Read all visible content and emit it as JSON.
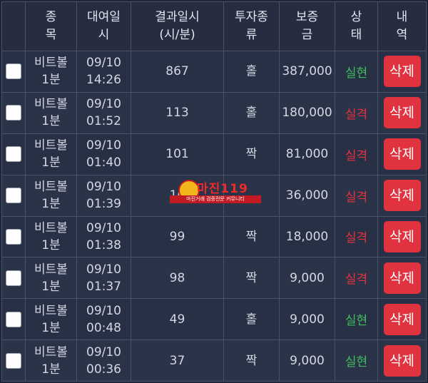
{
  "headers": {
    "check": "",
    "type": [
      "종",
      "목"
    ],
    "bet_time": [
      "대여일",
      "시"
    ],
    "result_time": [
      "결과일시",
      "(시/분)"
    ],
    "pick_type": [
      "투자종",
      "류"
    ],
    "amount": [
      "보증",
      "금"
    ],
    "status": [
      "상",
      "태"
    ],
    "action": [
      "내",
      "역"
    ]
  },
  "rows": [
    {
      "game": [
        "비트볼",
        "1분"
      ],
      "date": [
        "09/10",
        "14:26"
      ],
      "result": "867",
      "pick": "홀",
      "amount": "387,000",
      "status": "실현",
      "action": "삭제"
    },
    {
      "game": [
        "비트볼",
        "1분"
      ],
      "date": [
        "09/10",
        "01:52"
      ],
      "result": "113",
      "pick": "홀",
      "amount": "180,000",
      "status": "실격",
      "action": "삭제"
    },
    {
      "game": [
        "비트볼",
        "1분"
      ],
      "date": [
        "09/10",
        "01:40"
      ],
      "result": "101",
      "pick": "짝",
      "amount": "81,000",
      "status": "실격",
      "action": "삭제"
    },
    {
      "game": [
        "비트볼",
        "1분"
      ],
      "date": [
        "09/10",
        "01:39"
      ],
      "result": "10",
      "pick": "",
      "amount": "36,000",
      "status": "실격",
      "action": "삭제"
    },
    {
      "game": [
        "비트볼",
        "1분"
      ],
      "date": [
        "09/10",
        "01:38"
      ],
      "result": "99",
      "pick": "짝",
      "amount": "18,000",
      "status": "실격",
      "action": "삭제"
    },
    {
      "game": [
        "비트볼",
        "1분"
      ],
      "date": [
        "09/10",
        "01:37"
      ],
      "result": "98",
      "pick": "짝",
      "amount": "9,000",
      "status": "실격",
      "action": "삭제"
    },
    {
      "game": [
        "비트볼",
        "1분"
      ],
      "date": [
        "09/10",
        "00:48"
      ],
      "result": "49",
      "pick": "홀",
      "amount": "9,000",
      "status": "실현",
      "action": "삭제"
    },
    {
      "game": [
        "비트볼",
        "1분"
      ],
      "date": [
        "09/10",
        "00:36"
      ],
      "result": "37",
      "pick": "짝",
      "amount": "9,000",
      "status": "실현",
      "action": "삭제"
    }
  ],
  "status_colors": {
    "실현": "#3fbf5a",
    "실격": "#e8303a"
  },
  "watermark": {
    "title": "마진",
    "suffix": "119",
    "subtitle": "마진거래 검증전문 커뮤니티"
  }
}
